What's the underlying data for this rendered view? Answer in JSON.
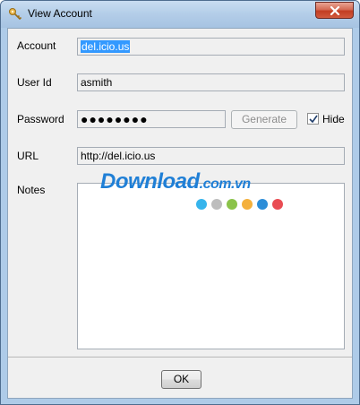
{
  "window": {
    "title": "View Account"
  },
  "form": {
    "account": {
      "label": "Account",
      "value": "del.icio.us"
    },
    "user_id": {
      "label": "User Id",
      "value": "asmith"
    },
    "password": {
      "label": "Password",
      "value": "●●●●●●●●"
    },
    "generate_label": "Generate",
    "hide": {
      "label": "Hide",
      "checked": true
    },
    "url": {
      "label": "URL",
      "value": "http://del.icio.us"
    },
    "notes": {
      "label": "Notes",
      "value": ""
    }
  },
  "footer": {
    "ok_label": "OK"
  },
  "watermark": {
    "brand": "Download",
    "suffix": ".com.vn",
    "dot_colors": [
      "#36b4ec",
      "#bdbdbd",
      "#8bc34a",
      "#f4b03c",
      "#2d8ed8",
      "#e94c53"
    ]
  },
  "icons": {
    "app": "key-icon",
    "close": "close-icon",
    "check": "checkmark-icon"
  }
}
